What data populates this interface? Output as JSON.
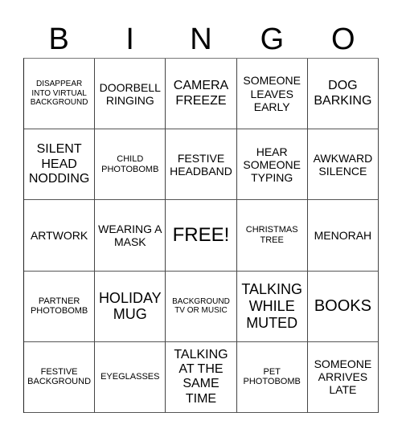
{
  "header": {
    "letters": [
      "B",
      "I",
      "N",
      "G",
      "O"
    ]
  },
  "cells": [
    [
      {
        "text": "DISAPPEAR INTO VIRTUAL BACKGROUND",
        "size": "s10"
      },
      {
        "text": "DOORBELL RINGING",
        "size": "s14"
      },
      {
        "text": "CAMERA FREEZE",
        "size": "s16"
      },
      {
        "text": "SOMEONE LEAVES EARLY",
        "size": "s14"
      },
      {
        "text": "DOG BARKING",
        "size": "s16"
      }
    ],
    [
      {
        "text": "SILENT HEAD NODDING",
        "size": "s16"
      },
      {
        "text": "CHILD PHOTOBOMB",
        "size": "s11"
      },
      {
        "text": "FESTIVE HEADBAND",
        "size": "s14"
      },
      {
        "text": "HEAR SOMEONE TYPING",
        "size": "s14"
      },
      {
        "text": "AWKWARD SILENCE",
        "size": "s14"
      }
    ],
    [
      {
        "text": "ARTWORK",
        "size": "s14"
      },
      {
        "text": "WEARING A MASK",
        "size": "s14"
      },
      {
        "text": "FREE!",
        "size": "s24"
      },
      {
        "text": "CHRISTMAS TREE",
        "size": "s11"
      },
      {
        "text": "MENORAH",
        "size": "s14"
      }
    ],
    [
      {
        "text": "PARTNER PHOTOBOMB",
        "size": "s11"
      },
      {
        "text": "HOLIDAY MUG",
        "size": "s18"
      },
      {
        "text": "BACKGROUND TV OR MUSIC",
        "size": "s10"
      },
      {
        "text": "TALKING WHILE MUTED",
        "size": "s18"
      },
      {
        "text": "BOOKS",
        "size": "s20"
      }
    ],
    [
      {
        "text": "FESTIVE BACKGROUND",
        "size": "s11"
      },
      {
        "text": "EYEGLASSES",
        "size": "s11"
      },
      {
        "text": "TALKING AT THE SAME TIME",
        "size": "s16"
      },
      {
        "text": "PET PHOTOBOMB",
        "size": "s11"
      },
      {
        "text": "SOMEONE ARRIVES LATE",
        "size": "s14"
      }
    ]
  ]
}
